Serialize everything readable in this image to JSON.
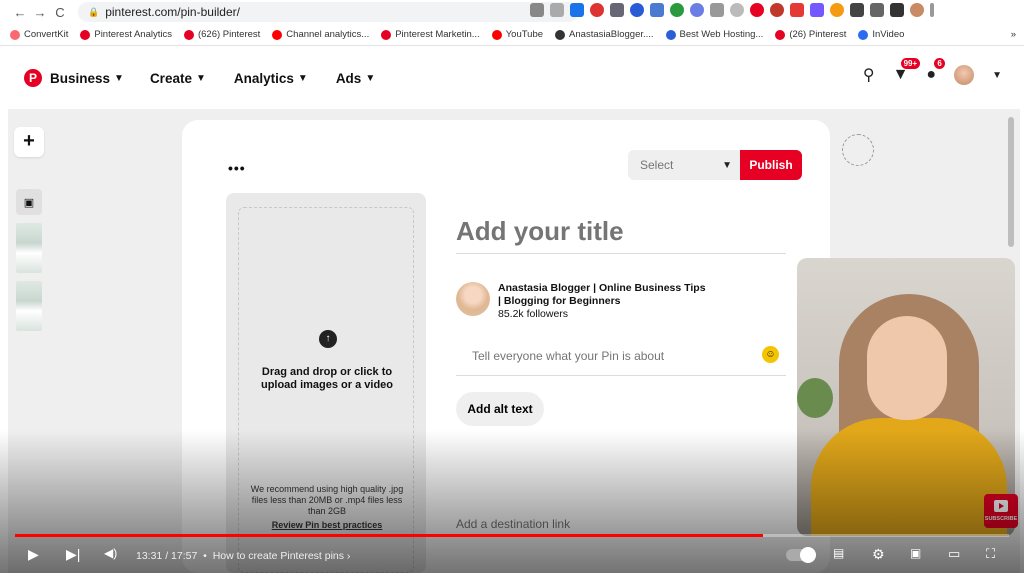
{
  "browser": {
    "url": "pinterest.com/pin-builder/",
    "back_icon": "←",
    "forward_icon": "→",
    "reload_icon": "C"
  },
  "bookmarks": [
    {
      "label": "ConvertKit",
      "color": "#fb6970"
    },
    {
      "label": "Pinterest Analytics",
      "color": "#e60023"
    },
    {
      "label": "(626) Pinterest",
      "color": "#e60023"
    },
    {
      "label": "Channel analytics...",
      "color": "#ff0000"
    },
    {
      "label": "Pinterest Marketin...",
      "color": "#e60023"
    },
    {
      "label": "YouTube",
      "color": "#ff0000"
    },
    {
      "label": "AnastasiaBlogger....",
      "color": "#333333"
    },
    {
      "label": "Best Web Hosting...",
      "color": "#2b5fd9"
    },
    {
      "label": "(26) Pinterest",
      "color": "#e60023"
    },
    {
      "label": "InVideo",
      "color": "#2b6cf0"
    }
  ],
  "bookmarks_more": "»",
  "header": {
    "logo": "P",
    "nav": [
      "Business",
      "Create",
      "Analytics",
      "Ads"
    ],
    "notifications_badge": "99+",
    "messages_badge": "6"
  },
  "builder": {
    "more_options": "•••",
    "board_select": "Select",
    "publish_label": "Publish",
    "upload_text": "Drag and drop or click to upload images or a video",
    "recommend_text": "We recommend using high quality .jpg files less than 20MB or .mp4 files less than 2GB",
    "review_link": "Review Pin best practices",
    "title_placeholder": "Add your title",
    "profile_name": "Anastasia Blogger | Online Business Tips | Blogging for Beginners",
    "profile_followers": "85.2k followers",
    "about_placeholder": "Tell everyone what your Pin is about",
    "alt_text_label": "Add alt text",
    "destination_placeholder": "Add a destination link",
    "add_pin": "+"
  },
  "video": {
    "current_time": "13:31",
    "duration": "17:57",
    "chapter": "How to create Pinterest pins",
    "progress_fraction": 0.753,
    "subscribe_label": "SUBSCRIBE"
  },
  "colors": {
    "pinterest_red": "#e60023",
    "progress_red": "#ff0000"
  }
}
